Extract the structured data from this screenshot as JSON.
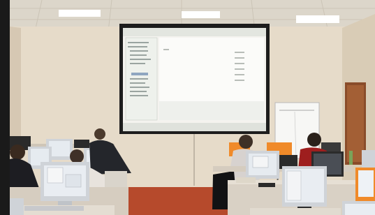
{
  "scene": {
    "kind": "photo",
    "setting": "computer-training-room",
    "colors": {
      "ceiling": "#ded8cc",
      "wall": "#e7dccb",
      "wall_shadow": "#d7cab6",
      "floor": "#b84a2a",
      "screen": "#f6f4f1",
      "screen_border": "#1d1d1d",
      "monitor_bezel": "#cfd3d8",
      "monitor_screen": "#e9edf2",
      "desk": "#d9d1c5",
      "orange_monitor": "#f08a29",
      "door": "#8a4c2a",
      "black_frame": "#1a1a1a"
    }
  }
}
